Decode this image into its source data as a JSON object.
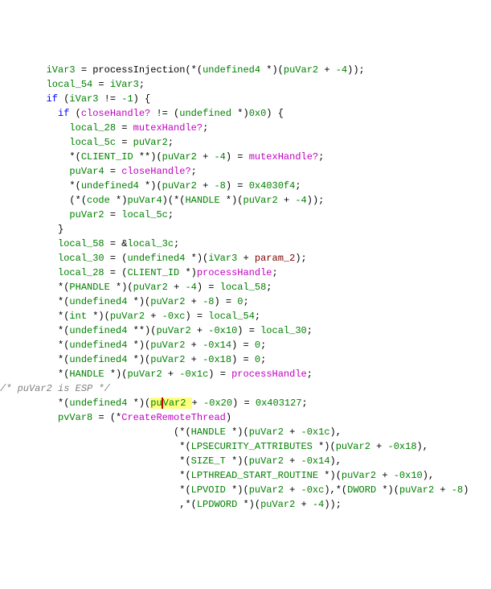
{
  "lines": [
    {
      "indent": 8,
      "segs": [
        {
          "t": "iVar3 ",
          "c": "id"
        },
        {
          "t": "= ",
          "c": "bk"
        },
        {
          "t": "processInjection",
          "c": "bk"
        },
        {
          "t": "(*(",
          "c": "bk"
        },
        {
          "t": "undefined4 ",
          "c": "id"
        },
        {
          "t": "*)(",
          "c": "bk"
        },
        {
          "t": "puVar2 ",
          "c": "id"
        },
        {
          "t": "+ ",
          "c": "bk"
        },
        {
          "t": "-4",
          "c": "num"
        },
        {
          "t": "));",
          "c": "bk"
        }
      ]
    },
    {
      "indent": 8,
      "segs": [
        {
          "t": "local_54 ",
          "c": "id"
        },
        {
          "t": "= ",
          "c": "bk"
        },
        {
          "t": "iVar3",
          "c": "id"
        },
        {
          "t": ";",
          "c": "bk"
        }
      ]
    },
    {
      "indent": 8,
      "segs": [
        {
          "t": "if ",
          "c": "kw2"
        },
        {
          "t": "(",
          "c": "bk"
        },
        {
          "t": "iVar3 ",
          "c": "id"
        },
        {
          "t": "!= ",
          "c": "bk"
        },
        {
          "t": "-1",
          "c": "num"
        },
        {
          "t": ") {",
          "c": "bk"
        }
      ]
    },
    {
      "indent": 10,
      "segs": [
        {
          "t": "if ",
          "c": "kw2"
        },
        {
          "t": "(",
          "c": "bk"
        },
        {
          "t": "closeHandle? ",
          "c": "glb"
        },
        {
          "t": "!= (",
          "c": "bk"
        },
        {
          "t": "undefined ",
          "c": "id"
        },
        {
          "t": "*)",
          "c": "bk"
        },
        {
          "t": "0x0",
          "c": "num"
        },
        {
          "t": ") {",
          "c": "bk"
        }
      ]
    },
    {
      "indent": 12,
      "segs": [
        {
          "t": "local_28 ",
          "c": "id"
        },
        {
          "t": "= ",
          "c": "bk"
        },
        {
          "t": "mutexHandle?",
          "c": "glb"
        },
        {
          "t": ";",
          "c": "bk"
        }
      ]
    },
    {
      "indent": 12,
      "segs": [
        {
          "t": "local_5c ",
          "c": "id"
        },
        {
          "t": "= ",
          "c": "bk"
        },
        {
          "t": "puVar2",
          "c": "id"
        },
        {
          "t": ";",
          "c": "bk"
        }
      ]
    },
    {
      "indent": 12,
      "segs": [
        {
          "t": "*(",
          "c": "bk"
        },
        {
          "t": "CLIENT_ID ",
          "c": "id"
        },
        {
          "t": "**)(",
          "c": "bk"
        },
        {
          "t": "puVar2 ",
          "c": "id"
        },
        {
          "t": "+ ",
          "c": "bk"
        },
        {
          "t": "-4",
          "c": "num"
        },
        {
          "t": ") = ",
          "c": "bk"
        },
        {
          "t": "mutexHandle?",
          "c": "glb"
        },
        {
          "t": ";",
          "c": "bk"
        }
      ]
    },
    {
      "indent": 12,
      "segs": [
        {
          "t": "puVar4 ",
          "c": "id"
        },
        {
          "t": "= ",
          "c": "bk"
        },
        {
          "t": "closeHandle?",
          "c": "glb"
        },
        {
          "t": ";",
          "c": "bk"
        }
      ]
    },
    {
      "indent": 12,
      "segs": [
        {
          "t": "*(",
          "c": "bk"
        },
        {
          "t": "undefined4 ",
          "c": "id"
        },
        {
          "t": "*)(",
          "c": "bk"
        },
        {
          "t": "puVar2 ",
          "c": "id"
        },
        {
          "t": "+ ",
          "c": "bk"
        },
        {
          "t": "-8",
          "c": "num"
        },
        {
          "t": ") = ",
          "c": "bk"
        },
        {
          "t": "0x4030f4",
          "c": "num"
        },
        {
          "t": ";",
          "c": "bk"
        }
      ]
    },
    {
      "indent": 12,
      "segs": [
        {
          "t": "(*(",
          "c": "bk"
        },
        {
          "t": "code ",
          "c": "id"
        },
        {
          "t": "*)",
          "c": "bk"
        },
        {
          "t": "puVar4",
          "c": "id"
        },
        {
          "t": ")(*(",
          "c": "bk"
        },
        {
          "t": "HANDLE ",
          "c": "id"
        },
        {
          "t": "*)(",
          "c": "bk"
        },
        {
          "t": "puVar2 ",
          "c": "id"
        },
        {
          "t": "+ ",
          "c": "bk"
        },
        {
          "t": "-4",
          "c": "num"
        },
        {
          "t": "));",
          "c": "bk"
        }
      ]
    },
    {
      "indent": 12,
      "segs": [
        {
          "t": "puVar2 ",
          "c": "id"
        },
        {
          "t": "= ",
          "c": "bk"
        },
        {
          "t": "local_5c",
          "c": "id"
        },
        {
          "t": ";",
          "c": "bk"
        }
      ]
    },
    {
      "indent": 10,
      "segs": [
        {
          "t": "}",
          "c": "bk"
        }
      ]
    },
    {
      "indent": 10,
      "segs": [
        {
          "t": "local_58 ",
          "c": "id"
        },
        {
          "t": "= &",
          "c": "bk"
        },
        {
          "t": "local_3c",
          "c": "id"
        },
        {
          "t": ";",
          "c": "bk"
        }
      ]
    },
    {
      "indent": 10,
      "segs": [
        {
          "t": "local_30 ",
          "c": "id"
        },
        {
          "t": "= (",
          "c": "bk"
        },
        {
          "t": "undefined4 ",
          "c": "id"
        },
        {
          "t": "*)(",
          "c": "bk"
        },
        {
          "t": "iVar3 ",
          "c": "id"
        },
        {
          "t": "+ ",
          "c": "bk"
        },
        {
          "t": "param_2",
          "c": "param"
        },
        {
          "t": ");",
          "c": "bk"
        }
      ]
    },
    {
      "indent": 10,
      "segs": [
        {
          "t": "local_28 ",
          "c": "id"
        },
        {
          "t": "= (",
          "c": "bk"
        },
        {
          "t": "CLIENT_ID ",
          "c": "id"
        },
        {
          "t": "*)",
          "c": "bk"
        },
        {
          "t": "processHandle",
          "c": "glb"
        },
        {
          "t": ";",
          "c": "bk"
        }
      ]
    },
    {
      "indent": 10,
      "segs": [
        {
          "t": "*(",
          "c": "bk"
        },
        {
          "t": "PHANDLE ",
          "c": "id"
        },
        {
          "t": "*)(",
          "c": "bk"
        },
        {
          "t": "puVar2 ",
          "c": "id"
        },
        {
          "t": "+ ",
          "c": "bk"
        },
        {
          "t": "-4",
          "c": "num"
        },
        {
          "t": ") = ",
          "c": "bk"
        },
        {
          "t": "local_58",
          "c": "id"
        },
        {
          "t": ";",
          "c": "bk"
        }
      ]
    },
    {
      "indent": 10,
      "segs": [
        {
          "t": "*(",
          "c": "bk"
        },
        {
          "t": "undefined4 ",
          "c": "id"
        },
        {
          "t": "*)(",
          "c": "bk"
        },
        {
          "t": "puVar2 ",
          "c": "id"
        },
        {
          "t": "+ ",
          "c": "bk"
        },
        {
          "t": "-8",
          "c": "num"
        },
        {
          "t": ") = ",
          "c": "bk"
        },
        {
          "t": "0",
          "c": "num"
        },
        {
          "t": ";",
          "c": "bk"
        }
      ]
    },
    {
      "indent": 10,
      "segs": [
        {
          "t": "*(",
          "c": "bk"
        },
        {
          "t": "int ",
          "c": "id"
        },
        {
          "t": "*)(",
          "c": "bk"
        },
        {
          "t": "puVar2 ",
          "c": "id"
        },
        {
          "t": "+ ",
          "c": "bk"
        },
        {
          "t": "-0xc",
          "c": "num"
        },
        {
          "t": ") = ",
          "c": "bk"
        },
        {
          "t": "local_54",
          "c": "id"
        },
        {
          "t": ";",
          "c": "bk"
        }
      ]
    },
    {
      "indent": 10,
      "segs": [
        {
          "t": "*(",
          "c": "bk"
        },
        {
          "t": "undefined4 ",
          "c": "id"
        },
        {
          "t": "**)(",
          "c": "bk"
        },
        {
          "t": "puVar2 ",
          "c": "id"
        },
        {
          "t": "+ ",
          "c": "bk"
        },
        {
          "t": "-0x10",
          "c": "num"
        },
        {
          "t": ") = ",
          "c": "bk"
        },
        {
          "t": "local_30",
          "c": "id"
        },
        {
          "t": ";",
          "c": "bk"
        }
      ]
    },
    {
      "indent": 10,
      "segs": [
        {
          "t": "*(",
          "c": "bk"
        },
        {
          "t": "undefined4 ",
          "c": "id"
        },
        {
          "t": "*)(",
          "c": "bk"
        },
        {
          "t": "puVar2 ",
          "c": "id"
        },
        {
          "t": "+ ",
          "c": "bk"
        },
        {
          "t": "-0x14",
          "c": "num"
        },
        {
          "t": ") = ",
          "c": "bk"
        },
        {
          "t": "0",
          "c": "num"
        },
        {
          "t": ";",
          "c": "bk"
        }
      ]
    },
    {
      "indent": 10,
      "segs": [
        {
          "t": "*(",
          "c": "bk"
        },
        {
          "t": "undefined4 ",
          "c": "id"
        },
        {
          "t": "*)(",
          "c": "bk"
        },
        {
          "t": "puVar2 ",
          "c": "id"
        },
        {
          "t": "+ ",
          "c": "bk"
        },
        {
          "t": "-0x18",
          "c": "num"
        },
        {
          "t": ") = ",
          "c": "bk"
        },
        {
          "t": "0",
          "c": "num"
        },
        {
          "t": ";",
          "c": "bk"
        }
      ]
    },
    {
      "indent": 10,
      "segs": [
        {
          "t": "*(",
          "c": "bk"
        },
        {
          "t": "HANDLE ",
          "c": "id"
        },
        {
          "t": "*)(",
          "c": "bk"
        },
        {
          "t": "puVar2 ",
          "c": "id"
        },
        {
          "t": "+ ",
          "c": "bk"
        },
        {
          "t": "-0x1c",
          "c": "num"
        },
        {
          "t": ") = ",
          "c": "bk"
        },
        {
          "t": "processHandle",
          "c": "glb"
        },
        {
          "t": ";",
          "c": "bk"
        }
      ]
    },
    {
      "indent": 0,
      "segs": [
        {
          "t": "/* puVar2 is ESP */",
          "c": "cm"
        }
      ]
    },
    {
      "indent": 10,
      "segs": [
        {
          "t": "*(",
          "c": "bk"
        },
        {
          "t": "undefined4 ",
          "c": "id"
        },
        {
          "t": "*)(",
          "c": "bk"
        },
        {
          "t": "pu",
          "c": "id",
          "hl": true
        },
        {
          "t": "",
          "caret": true
        },
        {
          "t": "Var2 ",
          "c": "id",
          "hl": true
        },
        {
          "t": "+ ",
          "c": "bk"
        },
        {
          "t": "-0x20",
          "c": "num"
        },
        {
          "t": ") = ",
          "c": "bk"
        },
        {
          "t": "0x403127",
          "c": "num"
        },
        {
          "t": ";",
          "c": "bk"
        }
      ]
    },
    {
      "indent": 10,
      "segs": [
        {
          "t": "pvVar8 ",
          "c": "id"
        },
        {
          "t": "= (*",
          "c": "bk"
        },
        {
          "t": "CreateRemoteThread",
          "c": "glb"
        },
        {
          "t": ")",
          "c": "bk"
        }
      ]
    },
    {
      "indent": 30,
      "segs": [
        {
          "t": "(*(",
          "c": "bk"
        },
        {
          "t": "HANDLE ",
          "c": "id"
        },
        {
          "t": "*)(",
          "c": "bk"
        },
        {
          "t": "puVar2 ",
          "c": "id"
        },
        {
          "t": "+ ",
          "c": "bk"
        },
        {
          "t": "-0x1c",
          "c": "num"
        },
        {
          "t": "),",
          "c": "bk"
        }
      ]
    },
    {
      "indent": 31,
      "segs": [
        {
          "t": "*(",
          "c": "bk"
        },
        {
          "t": "LPSECURITY_ATTRIBUTES ",
          "c": "id"
        },
        {
          "t": "*)(",
          "c": "bk"
        },
        {
          "t": "puVar2 ",
          "c": "id"
        },
        {
          "t": "+ ",
          "c": "bk"
        },
        {
          "t": "-0x18",
          "c": "num"
        },
        {
          "t": "),",
          "c": "bk"
        }
      ]
    },
    {
      "indent": 31,
      "segs": [
        {
          "t": "*(",
          "c": "bk"
        },
        {
          "t": "SIZE_T ",
          "c": "id"
        },
        {
          "t": "*)(",
          "c": "bk"
        },
        {
          "t": "puVar2 ",
          "c": "id"
        },
        {
          "t": "+ ",
          "c": "bk"
        },
        {
          "t": "-0x14",
          "c": "num"
        },
        {
          "t": "),",
          "c": "bk"
        }
      ]
    },
    {
      "indent": 31,
      "segs": [
        {
          "t": "*(",
          "c": "bk"
        },
        {
          "t": "LPTHREAD_START_ROUTINE ",
          "c": "id"
        },
        {
          "t": "*)(",
          "c": "bk"
        },
        {
          "t": "puVar2 ",
          "c": "id"
        },
        {
          "t": "+ ",
          "c": "bk"
        },
        {
          "t": "-0x10",
          "c": "num"
        },
        {
          "t": "),",
          "c": "bk"
        }
      ]
    },
    {
      "indent": 31,
      "segs": [
        {
          "t": "*(",
          "c": "bk"
        },
        {
          "t": "LPVOID ",
          "c": "id"
        },
        {
          "t": "*)(",
          "c": "bk"
        },
        {
          "t": "puVar2 ",
          "c": "id"
        },
        {
          "t": "+ ",
          "c": "bk"
        },
        {
          "t": "-0xc",
          "c": "num"
        },
        {
          "t": "),*(",
          "c": "bk"
        },
        {
          "t": "DWORD ",
          "c": "id"
        },
        {
          "t": "*)(",
          "c": "bk"
        },
        {
          "t": "puVar2 ",
          "c": "id"
        },
        {
          "t": "+ ",
          "c": "bk"
        },
        {
          "t": "-8",
          "c": "num"
        },
        {
          "t": ")",
          "c": "bk"
        }
      ]
    },
    {
      "indent": 31,
      "segs": [
        {
          "t": ",*(",
          "c": "bk"
        },
        {
          "t": "LPDWORD ",
          "c": "id"
        },
        {
          "t": "*)(",
          "c": "bk"
        },
        {
          "t": "puVar2 ",
          "c": "id"
        },
        {
          "t": "+ ",
          "c": "bk"
        },
        {
          "t": "-4",
          "c": "num"
        },
        {
          "t": "));",
          "c": "bk"
        }
      ]
    }
  ]
}
